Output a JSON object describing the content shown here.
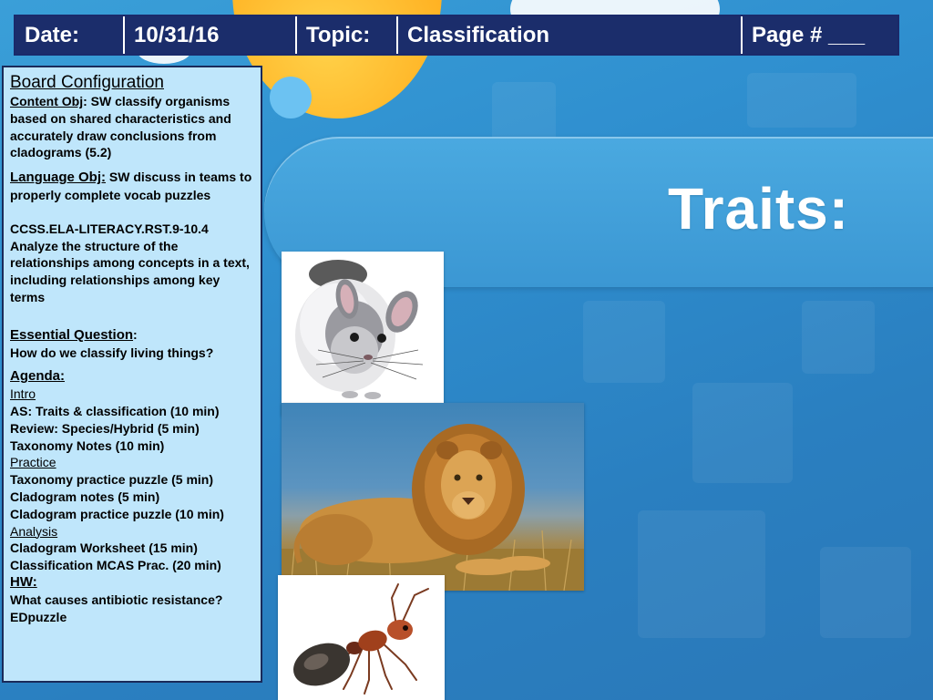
{
  "header": {
    "date_label": "Date:",
    "date_value": "10/31/16",
    "topic_label": "Topic:",
    "topic_value": "Classification",
    "page_label": "Page # ___"
  },
  "board": {
    "title": "Board Configuration",
    "content_obj_label": "Content Obj",
    "content_obj_text": ": SW classify organisms based on shared characteristics and accurately draw conclusions from cladograms (5.2)",
    "language_obj_label": "Language Obj:",
    "language_obj_text": " SW discuss in teams to properly complete vocab puzzles",
    "standard_code": "CCSS.ELA-LITERACY.RST.9-10.4",
    "standard_text": "Analyze the structure of the relationships among concepts in a text, including relationships among key terms",
    "eq_label": "Essential Question",
    "eq_colon": ":",
    "eq_text": "How do we classify living things?",
    "agenda_label": "Agenda:",
    "agenda": [
      {
        "text": "Intro",
        "heading": true
      },
      {
        "text": "AS: Traits & classification (10 min)",
        "heading": false
      },
      {
        "text": "Review: Species/Hybrid (5 min)",
        "heading": false
      },
      {
        "text": "Taxonomy Notes (10 min)",
        "heading": false
      },
      {
        "text": "Practice",
        "heading": true
      },
      {
        "text": "Taxonomy practice puzzle (5 min)",
        "heading": false
      },
      {
        "text": "Cladogram notes (5 min)",
        "heading": false
      },
      {
        "text": "Cladogram practice puzzle (10 min)",
        "heading": false
      },
      {
        "text": "Analysis",
        "heading": true
      },
      {
        "text": "Cladogram Worksheet (15 min)",
        "heading": false
      },
      {
        "text": "Classification MCAS Prac. (20 min)",
        "heading": false
      }
    ],
    "hw_label": "HW:",
    "hw_items": [
      "What causes antibiotic resistance?",
      "EDpuzzle"
    ]
  },
  "slide": {
    "title": "Traits:"
  },
  "colors": {
    "header_bg": "#1b2d6b",
    "panel_bg": "#bfe6fb",
    "slide_bg": "#2f8fcf",
    "accent_orange": "#ffb324"
  }
}
